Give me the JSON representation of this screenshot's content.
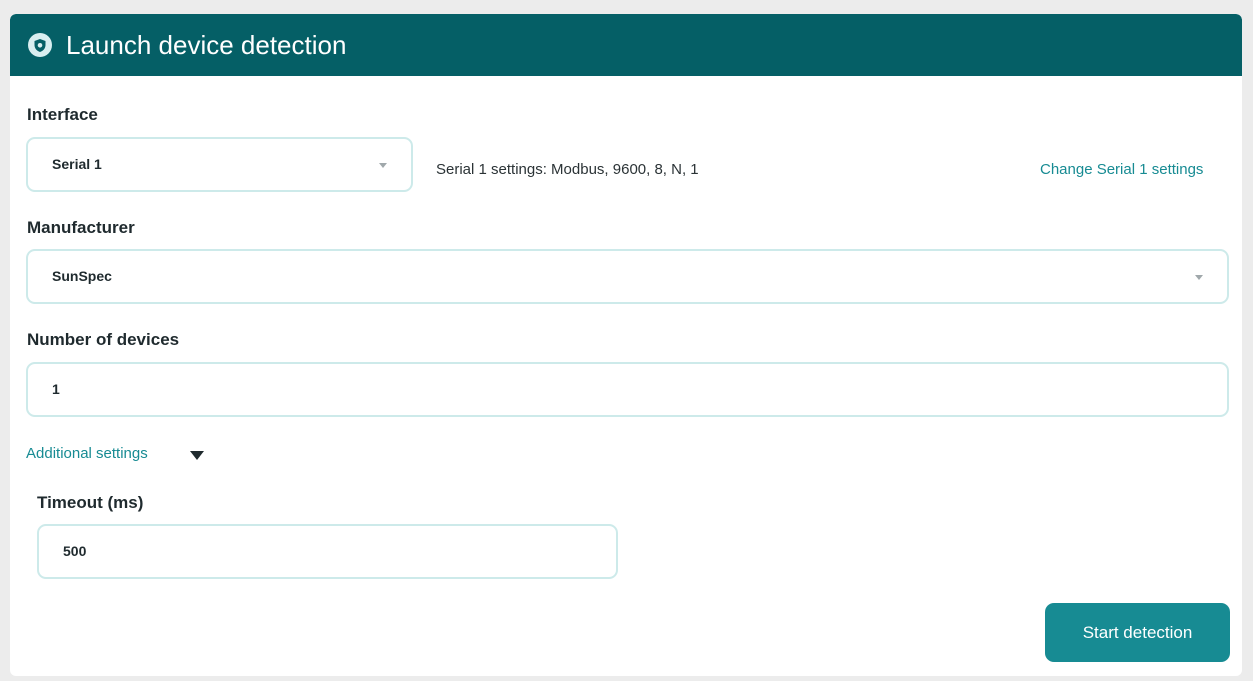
{
  "header": {
    "title": "Launch device detection",
    "icon": "shield-icon"
  },
  "interface": {
    "label": "Interface",
    "value": "Serial 1",
    "settings_text": "Serial 1 settings: Modbus, 9600, 8, N, 1",
    "change_link": "Change Serial 1 settings"
  },
  "manufacturer": {
    "label": "Manufacturer",
    "value": "SunSpec"
  },
  "devices": {
    "label": "Number of devices",
    "value": "1"
  },
  "additional": {
    "label": "Additional settings",
    "expanded": true
  },
  "timeout": {
    "label": "Timeout (ms)",
    "value": "500"
  },
  "actions": {
    "start_label": "Start detection"
  },
  "colors": {
    "header_bg": "#055f66",
    "accent": "#178b93",
    "field_border": "#cdeaea"
  }
}
